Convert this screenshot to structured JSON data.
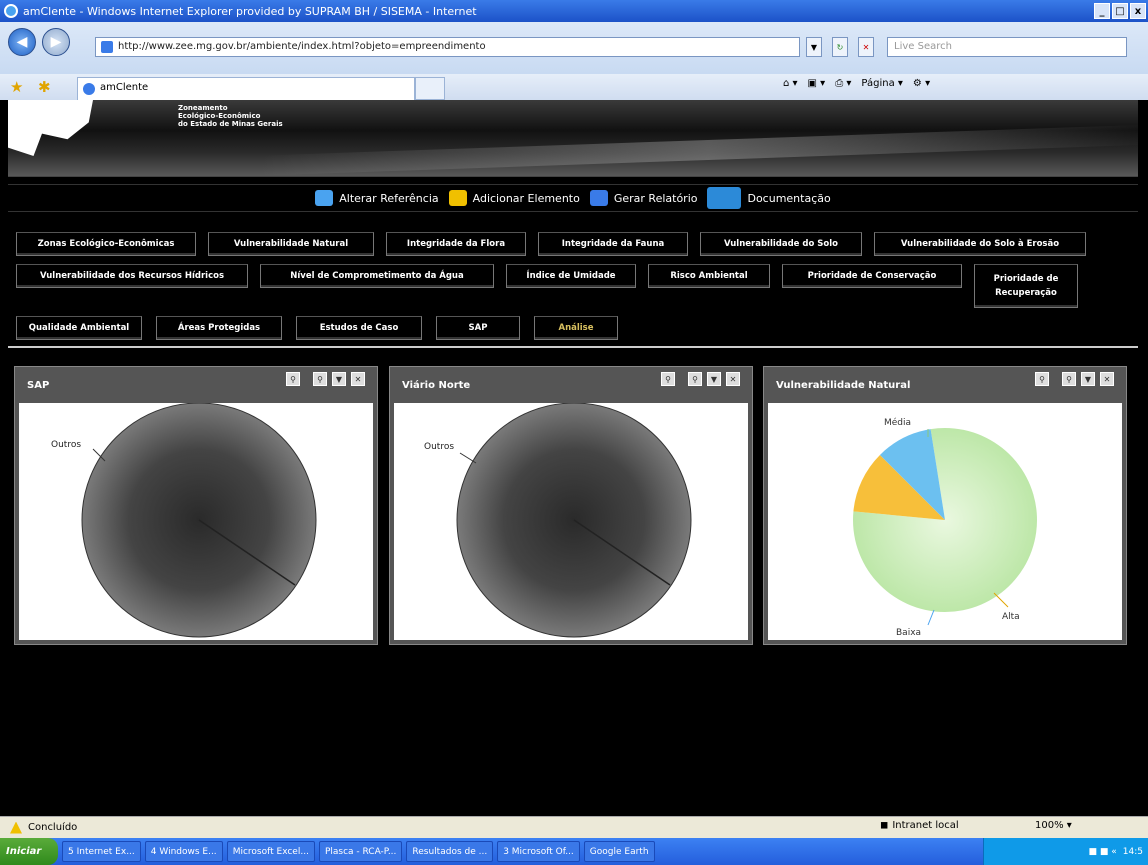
{
  "window": {
    "title": "amClente - Windows Internet Explorer provided by SUPRAM BH / SISEMA - Internet",
    "buttons": [
      "_",
      "□",
      "x"
    ]
  },
  "address": {
    "url": "http://www.zee.mg.gov.br/ambiente/index.html?objeto=empreendimento",
    "search_placeholder": "Live Search"
  },
  "tabs": {
    "active_label": "amClente"
  },
  "command_bar": {
    "page_label": "Página"
  },
  "header": {
    "brand_line1": "Zoneamento",
    "brand_line2": "Ecológico-Econômico",
    "brand_line3": "do Estado de Minas Gerais"
  },
  "toolbar": {
    "items": [
      {
        "label": "Alterar Referência",
        "icon": "reference-icon",
        "color": "#4aa3f0"
      },
      {
        "label": "Adicionar Elemento",
        "icon": "add-element-icon",
        "color": "#f0c000"
      },
      {
        "label": "Gerar Relatório",
        "icon": "report-icon",
        "color": "#3a7be8"
      },
      {
        "label": "Documentação",
        "icon": "documentation-icon",
        "color": "#2c8ad8"
      }
    ]
  },
  "layers": {
    "row1": [
      "Zonas Ecológico-Econômicas",
      "Vulnerabilidade Natural",
      "Integridade da Flora",
      "Integridade da Fauna",
      "Vulnerabilidade do Solo",
      "Vulnerabilidade do Solo à Erosão"
    ],
    "row2": [
      "Vulnerabilidade dos Recursos Hídricos",
      "Nível de Comprometimento da Água",
      "Índice de Umidade",
      "Risco Ambiental",
      "Prioridade de Conservação",
      "Prioridade de Recuperação"
    ],
    "row3": [
      "Qualidade Ambiental",
      "Áreas Protegidas",
      "Estudos de Caso",
      "SAP",
      "Análise"
    ],
    "active": "Análise"
  },
  "panels": [
    {
      "title": "SAP",
      "label": "Outros"
    },
    {
      "title": "Viário Norte",
      "label": "Outros"
    },
    {
      "title": "Vulnerabilidade Natural",
      "labels": [
        "Média",
        "Alta",
        "Baixa"
      ]
    }
  ],
  "chart_data": [
    {
      "type": "pie",
      "title": "SAP",
      "categories": [
        "Outros"
      ],
      "values": [
        100
      ]
    },
    {
      "type": "pie",
      "title": "Viário Norte",
      "categories": [
        "Outros"
      ],
      "values": [
        100
      ]
    },
    {
      "type": "pie",
      "title": "Vulnerabilidade Natural",
      "categories": [
        "Média",
        "Alta",
        "Baixa"
      ],
      "values": [
        79,
        11,
        10
      ],
      "colors": [
        "#bde7a8",
        "#f7bf3a",
        "#6cc0f0"
      ]
    }
  ],
  "statusbar": {
    "status": "Concluído",
    "zone": "Intranet local",
    "zoom": "100%"
  },
  "taskbar": {
    "start": "Iniciar",
    "items": [
      "5 Internet Ex...",
      "4 Windows E...",
      "Microsoft Excel...",
      "Plasca - RCA-P...",
      "Resultados de ...",
      "3 Microsoft Of...",
      "Google Earth"
    ],
    "clock": "14:5"
  }
}
